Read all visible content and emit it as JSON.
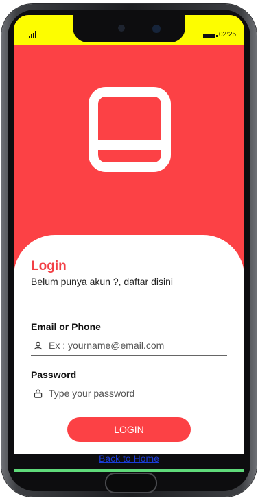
{
  "status_bar": {
    "time": "02:25"
  },
  "colors": {
    "primary": "#fc4145",
    "status_bar": "#fdfd00",
    "link": "#1a3cd8"
  },
  "icons": {
    "logo": "app-logo-icon",
    "email": "user-icon",
    "password": "lock-icon"
  },
  "login": {
    "title": "Login",
    "subtitle": "Belum punya akun ?, daftar disini",
    "email_label": "Email or Phone",
    "email_placeholder": "Ex : yourname@email.com",
    "email_value": "",
    "password_label": "Password",
    "password_placeholder": "Type your password",
    "password_value": "",
    "button_label": "LOGIN",
    "back_link": "Back to Home"
  }
}
